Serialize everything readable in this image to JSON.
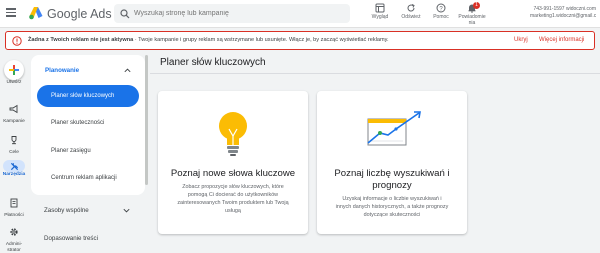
{
  "header": {
    "brand": "Google Ads",
    "search_placeholder": "Wyszukaj stronę lub kampanię",
    "buttons": {
      "appearance": "Wygląd",
      "refresh": "Odśwież",
      "help": "Pomoc",
      "notifications": "Powiadomie nia",
      "notifications_count": "1"
    },
    "account": {
      "id": "743-991-1597 widoczni.com",
      "email": "marketing1.widoczni@gmail.c..."
    }
  },
  "alert": {
    "bold_text": "Żadna z Twoich reklam nie jest aktywna",
    "text": " · Twoje kampanie i grupy reklam są wstrzymane lub usunięte. Włącz je, by zacząć wyświetlać reklamy.",
    "hide_link": "Ukryj",
    "more_link": "Więcej informacji"
  },
  "rail": {
    "create": "Utwórz",
    "campaigns": "Kampanie",
    "goals": "Cele",
    "tools": "Narzędzia",
    "billing": "Płatności",
    "admin": "Admini-strator"
  },
  "subnav": {
    "heading": "Planowanie",
    "items": [
      {
        "label": "Planer słów kluczowych",
        "active": true
      },
      {
        "label": "Planer skuteczności",
        "active": false
      },
      {
        "label": "Planer zasięgu",
        "active": false
      },
      {
        "label": "Centrum reklam aplikacji",
        "active": false
      }
    ],
    "shared_library": "Zasoby wspólne",
    "content_suitability": "Dopasowanie treści"
  },
  "main": {
    "title": "Planer słów kluczowych",
    "cards": [
      {
        "title": "Poznaj nowe słowa kluczowe",
        "desc_lines": [
          "Zobacz propozycje słów kluczowych, które",
          "pomogą Ci docierać do użytkowników",
          "zainteresowanych Twoim produktem lub Twoją",
          "usługą"
        ]
      },
      {
        "title_lines": [
          "Poznaj liczbę wyszukiwań i",
          "prognozy"
        ],
        "desc_lines": [
          "Uzyskaj informacje o liczbie wyszukiwań i",
          "innych danych historycznych, a także prognozy",
          "dotyczące skuteczności"
        ]
      }
    ]
  },
  "colors": {
    "accent": "#1a73e8",
    "alert": "#d93025",
    "bulb": "#fbbc04"
  }
}
